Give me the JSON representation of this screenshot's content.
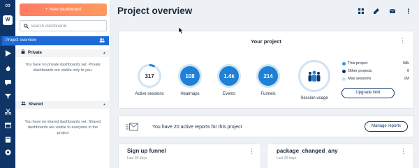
{
  "rail": {
    "logo_icon": "infinity-logo-icon",
    "workspace_initial": "W",
    "items": [
      "dashboard-icon",
      "play-icon",
      "fire-icon",
      "chat-icon",
      "inbox-icon",
      "scissors-icon",
      "calendar-icon",
      "book-icon",
      "settings-icon"
    ]
  },
  "sidebar": {
    "new_dashboard": "+ New dashboard",
    "search_placeholder": "Search dashboards",
    "selected_item": "Project overview",
    "private_title": "Private",
    "private_empty": "You have no private dashboards yet. Private dashboards are visible only to you.",
    "shared_title": "Shared",
    "shared_empty": "You have no shared dashboards yet. Shared dashboards are visible to everyone in the project"
  },
  "header": {
    "title": "Project overview",
    "toolbar": [
      "grid-icon",
      "edit-icon",
      "mail-icon",
      "more-vertical-icon"
    ]
  },
  "project_card": {
    "title": "Your project",
    "stats": [
      {
        "value": "317",
        "label": "Active sessions",
        "fill_fraction": 0.08
      },
      {
        "value": "108",
        "label": "Heatmaps",
        "fill_fraction": 1
      },
      {
        "value": "1.4k",
        "label": "Events",
        "fill_fraction": 1
      },
      {
        "value": "214",
        "label": "Funnels",
        "fill_fraction": 1
      }
    ],
    "session_usage_label": "Session usage",
    "legend": [
      {
        "label": "This project",
        "value": "58k",
        "color": "#2e9be0"
      },
      {
        "label": "Other projects",
        "value": "0",
        "color": "#0f3567"
      },
      {
        "label": "Max sessions",
        "value": "1M",
        "color": "#c7dff3"
      }
    ],
    "upgrade_label": "Upgrade limit"
  },
  "reports_banner": {
    "text": "You have 20 active reports for this project",
    "button": "Manage reports"
  },
  "widgets": [
    {
      "title": "Sign up funnel",
      "subtitle": "Last 30 days"
    },
    {
      "title": "package_changed_any",
      "subtitle": "Last 30 days"
    }
  ],
  "colors": {
    "brand_navy": "#0f3567",
    "accent_blue": "#1e6bd6",
    "stat_fill": "#1e80d6",
    "ring_light": "#cfe3f5",
    "new_button": "#ff8a61"
  }
}
